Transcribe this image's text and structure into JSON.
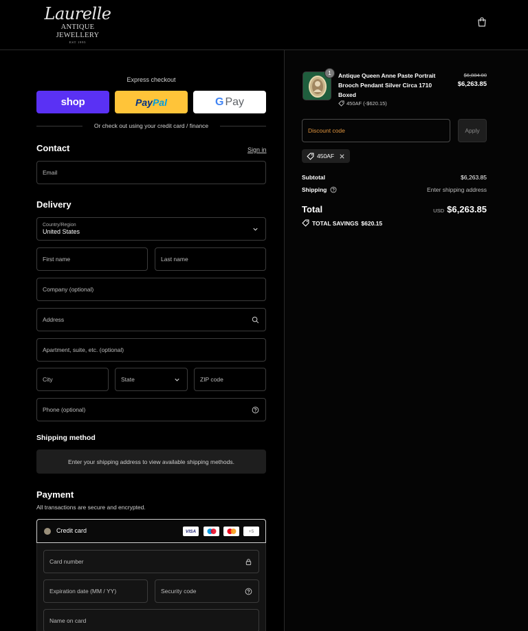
{
  "brand": {
    "name": "Laurelle",
    "subtitle": "ANTIQUE JEWELLERY",
    "established": "EST 1995"
  },
  "express": {
    "label": "Express checkout",
    "shop_label": "shop",
    "paypal_label_1": "Pay",
    "paypal_label_2": "Pal",
    "gpay_g": "G",
    "gpay_label": "Pay",
    "or_text": "Or check out using your credit card / finance"
  },
  "contact": {
    "title": "Contact",
    "signin": "Sign in",
    "email_placeholder": "Email"
  },
  "delivery": {
    "title": "Delivery",
    "country_label": "Country/Region",
    "country_value": "United States",
    "first_name": "First name",
    "last_name": "Last name",
    "company": "Company (optional)",
    "address": "Address",
    "apartment": "Apartment, suite, etc. (optional)",
    "city": "City",
    "state": "State",
    "zip": "ZIP code",
    "phone": "Phone (optional)"
  },
  "shipping_method": {
    "title": "Shipping method",
    "message": "Enter your shipping address to view available shipping methods."
  },
  "payment": {
    "title": "Payment",
    "subtitle": "All transactions are secure and encrypted.",
    "method_label": "Credit card",
    "card_brands": [
      "VISA",
      "maestro",
      "mastercard",
      "+5"
    ],
    "more_cards": "+5",
    "card_number": "Card number",
    "expiration": "Expiration date (MM / YY)",
    "security_code": "Security code",
    "name_on_card": "Name on card"
  },
  "order": {
    "quantity": "1",
    "product_name": "Antique Queen Anne Paste Portrait Brooch Pendant Silver Circa 1710 Boxed",
    "discount_line": "450AF (-$620.15)",
    "original_price": "$6,884.00",
    "price": "$6,263.85"
  },
  "discount": {
    "placeholder": "Discount code",
    "apply_label": "Apply",
    "applied_code": "450AF"
  },
  "summary": {
    "subtotal_label": "Subtotal",
    "subtotal_value": "$6,263.85",
    "shipping_label": "Shipping",
    "shipping_value": "Enter shipping address",
    "total_label": "Total",
    "currency": "USD",
    "total_value": "$6,263.85",
    "savings_label": "TOTAL SAVINGS",
    "savings_value": "$620.15"
  },
  "colors": {
    "background": "#000000",
    "shop_purple": "#5a31f4",
    "paypal_yellow": "#ffc439",
    "discount_accent": "#e0953f"
  }
}
